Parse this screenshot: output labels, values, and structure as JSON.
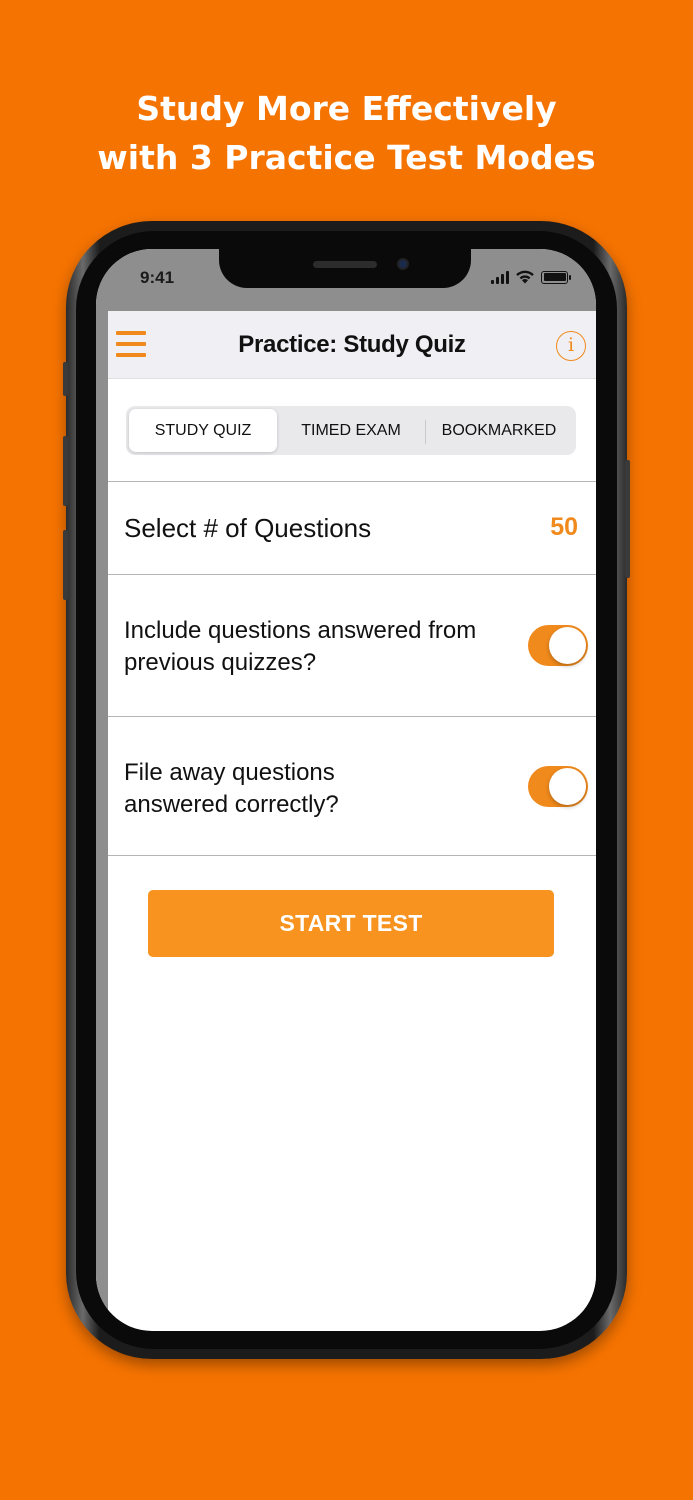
{
  "promo": {
    "line1": "Study More Effectively",
    "line2": "with 3 Practice Test Modes"
  },
  "status_bar": {
    "time": "9:41"
  },
  "navbar": {
    "title": "Practice: Study Quiz",
    "menu_icon": "hamburger-menu-icon",
    "info_icon": "info-icon",
    "info_glyph": "i"
  },
  "tabs": [
    {
      "label": "STUDY QUIZ",
      "selected": true
    },
    {
      "label": "TIMED EXAM",
      "selected": false
    },
    {
      "label": "BOOKMARKED",
      "selected": false
    }
  ],
  "settings": {
    "questions": {
      "label": "Select # of Questions",
      "value": "50"
    },
    "include_previous": {
      "label_line1": "Include questions answered from",
      "label_line2": "previous quizzes?",
      "on": true
    },
    "file_away": {
      "label_line1": "File away questions",
      "label_line2": "answered correctly?",
      "on": true
    }
  },
  "start_button": {
    "label": "START TEST"
  },
  "colors": {
    "background": "#f57300",
    "accent": "#f08a1c",
    "button": "#f7931e"
  }
}
